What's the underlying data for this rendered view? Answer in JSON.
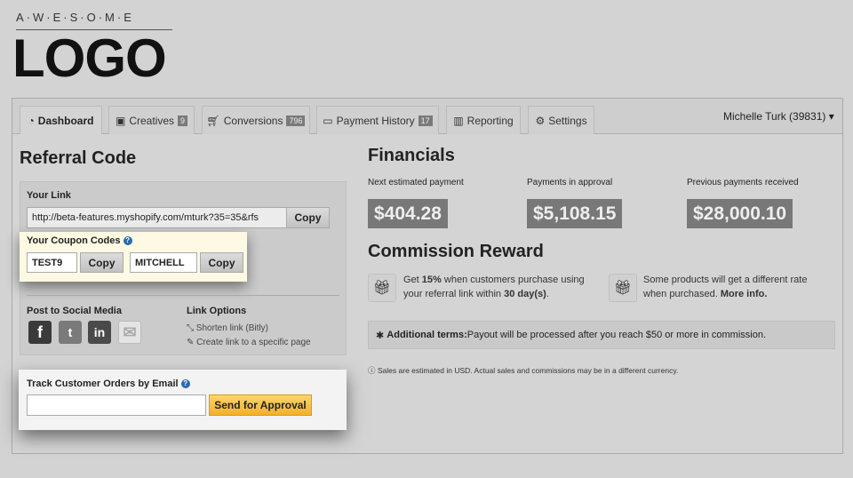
{
  "logo": {
    "tagline": "A·W·E·S·O·M·E",
    "name": "LOGO"
  },
  "tabs": [
    {
      "label": "Dashboard",
      "icon": "dashboard-icon",
      "active": true
    },
    {
      "label": "Creatives",
      "icon": "image-icon",
      "badge": "9"
    },
    {
      "label": "Conversions",
      "icon": "cart-icon",
      "badge": "796"
    },
    {
      "label": "Payment History",
      "icon": "money-icon",
      "badge": "17"
    },
    {
      "label": "Reporting",
      "icon": "bar-chart-icon"
    },
    {
      "label": "Settings",
      "icon": "gear-icon"
    }
  ],
  "user": {
    "label": "Michelle Turk (39831) ▾"
  },
  "referral": {
    "title": "Referral Code",
    "link_label": "Your Link",
    "link_value": "http://beta-features.myshopify.com/mturk?35=35&rfs",
    "copy": "Copy",
    "coupon_label": "Your Coupon Codes",
    "coupons": [
      "TEST9",
      "MITCHELL"
    ],
    "social_label": "Post to Social Media",
    "link_options_label": "Link Options",
    "link_options": [
      "Shorten link (Bitly)",
      "Create link to a specific page"
    ]
  },
  "track": {
    "label": "Track Customer Orders by Email",
    "email_value": "",
    "button": "Send for Approval"
  },
  "financials": {
    "title": "Financials",
    "items": [
      {
        "label": "Next estimated payment",
        "value": "$404.28"
      },
      {
        "label": "Payments in approval",
        "value": "$5,108.15"
      },
      {
        "label": "Previous payments received",
        "value": "$28,000.10"
      }
    ]
  },
  "commission": {
    "title": "Commission Reward",
    "r1_a": "Get ",
    "r1_b": "15%",
    "r1_c": " when customers purchase using",
    "r1_d": "your referral link within ",
    "r1_e": "30 day(s)",
    "r1_f": ".",
    "r2_a": "Some products will get a different rate",
    "r2_b": "when purchased. ",
    "r2_c": "More info.",
    "terms_bold": "Additional terms:",
    "terms_text": " Payout will be processed after you reach $50 or more in commission.",
    "note": "Sales are estimated in USD. Actual sales and commissions may be in a different currency."
  },
  "colors": {
    "accent": "#f5b731",
    "background": "#d3d3d3",
    "money_box": "#787878"
  }
}
